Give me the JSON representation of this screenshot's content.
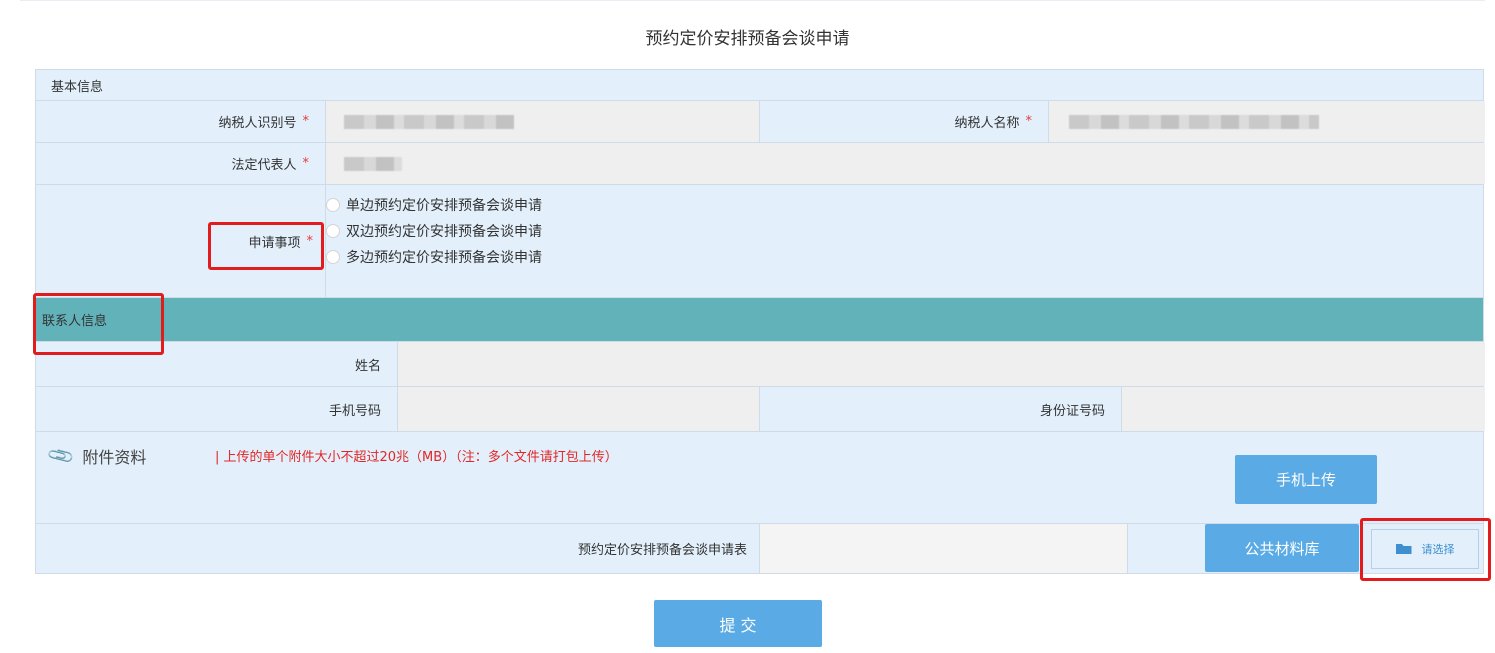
{
  "page_title": "预约定价安排预备会谈申请",
  "basic": {
    "section_label": "基本信息",
    "taxpayer_id_label": "纳税人识别号",
    "taxpayer_name_label": "纳税人名称",
    "legal_rep_label": "法定代表人",
    "application_label": "申请事项",
    "required_mark": "*",
    "options": [
      "单边预约定价安排预备会谈申请",
      "双边预约定价安排预备会谈申请",
      "多边预约定价安排预备会谈申请"
    ]
  },
  "contact": {
    "section_label": "联系人信息",
    "name_label": "姓名",
    "phone_label": "手机号码",
    "id_label": "身份证号码"
  },
  "attachments": {
    "title": "附件资料",
    "note": "| 上传的单个附件大小不超过20兆（MB）（注：多个文件请打包上传）",
    "mobile_upload": "手机上传",
    "file_label": "预约定价安排预备会谈申请表",
    "public_library": "公共材料库",
    "choose": "请选择"
  },
  "submit_label": "提 交",
  "colors": {
    "label_bg": "#e3f0fb",
    "value_bg": "#efefef",
    "teal": "#62b2ba",
    "button_blue": "#5aabe5",
    "highlight_red": "#e21c1c"
  }
}
